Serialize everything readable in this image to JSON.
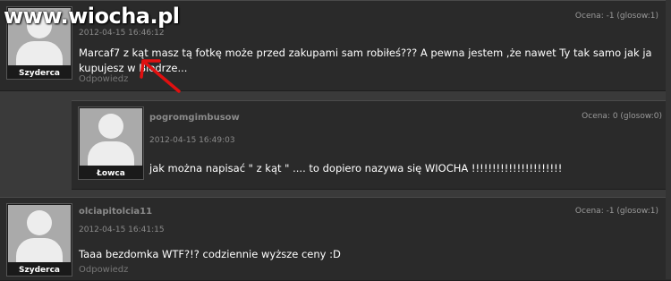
{
  "watermark": "www.wiocha.pl",
  "comments": [
    {
      "author": "",
      "date": "2012-04-15 16:46:12",
      "rating": "Ocena: -1 (glosow:1)",
      "rank": "Szyderca",
      "text": "Marcaf7 z kąt masz tą fotkę może przed zakupami sam robiłeś??? A pewna jestem ,że nawet Ty tak samo jak ja kupujesz w Biedrze...",
      "reply": "Odpowiedz"
    },
    {
      "author": "pogromgimbusow",
      "date": "2012-04-15 16:49:03",
      "rating": "Ocena: 0 (glosow:0)",
      "rank": "Łowca",
      "text": "jak można napisać \" z kąt \" .... to dopiero nazywa się WIOCHA !!!!!!!!!!!!!!!!!!!!!!",
      "reply": ""
    },
    {
      "author": "olciapitolcia11",
      "date": "2012-04-15 16:41:15",
      "rating": "Ocena: -1 (glosow:1)",
      "rank": "Szyderca",
      "text": "Taaa bezdomka WTF?!? codziennie wyższe ceny :D",
      "reply": "Odpowiedz"
    }
  ],
  "colors": {
    "annotation_arrow": "#e01010"
  }
}
